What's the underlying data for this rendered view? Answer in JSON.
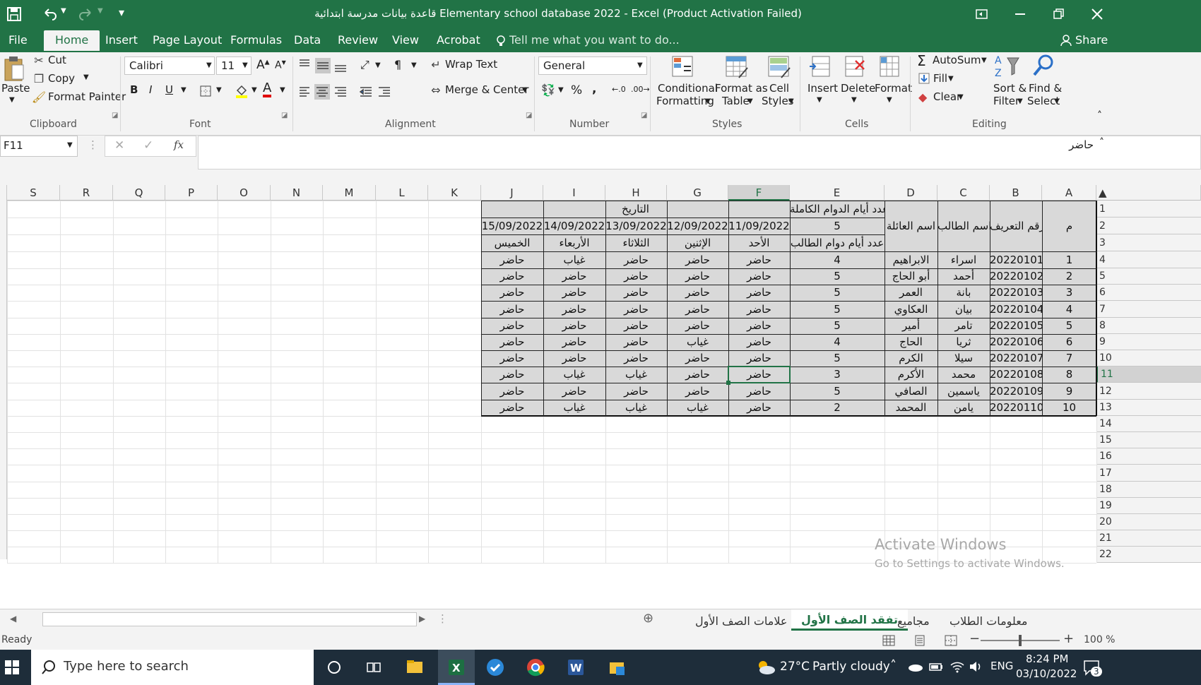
{
  "window": {
    "title": "قاعدة بيانات مدرسة ابتدائية Elementary school database 2022 - Excel (Product Activation Failed)",
    "restore_icon": "restore-icon",
    "minimize_icon": "minimize-icon",
    "maximize_icon": "maximize-icon",
    "close_icon": "close-icon"
  },
  "ribbon_tabs": [
    "File",
    "Home",
    "Insert",
    "Page Layout",
    "Formulas",
    "Data",
    "Review",
    "View",
    "Acrobat"
  ],
  "tell_me": "Tell me what you want to do...",
  "share": "Share",
  "clipboard": {
    "paste": "Paste",
    "cut": "Cut",
    "copy": "Copy",
    "format_painter": "Format Painter",
    "label": "Clipboard"
  },
  "font": {
    "name": "Calibri",
    "size": "11",
    "bold": "B",
    "italic": "I",
    "underline": "U",
    "label": "Font"
  },
  "alignment": {
    "wrap_text": "Wrap Text",
    "merge_center": "Merge & Center",
    "label": "Alignment"
  },
  "number": {
    "format": "General",
    "percent": "%",
    "comma": ",",
    "label": "Number"
  },
  "styles": {
    "conditional": "Conditional",
    "conditional2": "Formatting",
    "format_as": "Format as",
    "table": "Table",
    "cell": "Cell",
    "cell2": "Styles",
    "label": "Styles"
  },
  "cells": {
    "insert": "Insert",
    "delete": "Delete",
    "format": "Format",
    "label": "Cells"
  },
  "editing": {
    "autosum": "AutoSum",
    "fill": "Fill",
    "clear": "Clear",
    "sort": "Sort &",
    "sort2": "Filter",
    "find": "Find &",
    "find2": "Select",
    "label": "Editing"
  },
  "formula_bar": {
    "name_box": "F11",
    "fx": "fx",
    "value": "حاضر"
  },
  "columns": [
    "S",
    "R",
    "Q",
    "P",
    "O",
    "N",
    "M",
    "L",
    "K",
    "J",
    "I",
    "H",
    "G",
    "F",
    "E",
    "D",
    "C",
    "B",
    "A"
  ],
  "row_numbers": [
    "1",
    "2",
    "3",
    "4",
    "5",
    "6",
    "7",
    "8",
    "9",
    "10",
    "11",
    "12",
    "13",
    "14",
    "15",
    "16",
    "17",
    "18",
    "19",
    "20",
    "21",
    "22"
  ],
  "table": {
    "header_m": "م",
    "header_id": "رقم التعريف",
    "header_name": "اسم الطالب",
    "header_family": "اسم العائلة",
    "header_full_days": "عدد أيام الدوام الكاملة",
    "full_days_value": "5",
    "header_student_days": "عدد أيام دوام الطالب",
    "header_date": "التاريخ",
    "dates": [
      "11/09/2022",
      "12/09/2022",
      "13/09/2022",
      "14/09/2022",
      "15/09/2022"
    ],
    "days": [
      "الأحد",
      "الإثنين",
      "الثلاثاء",
      "الأربعاء",
      "الخميس"
    ],
    "rows": [
      {
        "m": "1",
        "id": "20220101",
        "name": "اسراء",
        "family": "الابراهيم",
        "count": "4",
        "att": [
          "حاضر",
          "حاضر",
          "حاضر",
          "غياب",
          "حاضر"
        ]
      },
      {
        "m": "2",
        "id": "20220102",
        "name": "أحمد",
        "family": "أبو الحاج",
        "count": "5",
        "att": [
          "حاضر",
          "حاضر",
          "حاضر",
          "حاضر",
          "حاضر"
        ]
      },
      {
        "m": "3",
        "id": "20220103",
        "name": "بانة",
        "family": "العمر",
        "count": "5",
        "att": [
          "حاضر",
          "حاضر",
          "حاضر",
          "حاضر",
          "حاضر"
        ]
      },
      {
        "m": "4",
        "id": "20220104",
        "name": "بيان",
        "family": "العكاوي",
        "count": "5",
        "att": [
          "حاضر",
          "حاضر",
          "حاضر",
          "حاضر",
          "حاضر"
        ]
      },
      {
        "m": "5",
        "id": "20220105",
        "name": "تامر",
        "family": "أمير",
        "count": "5",
        "att": [
          "حاضر",
          "حاضر",
          "حاضر",
          "حاضر",
          "حاضر"
        ]
      },
      {
        "m": "6",
        "id": "20220106",
        "name": "ثريا",
        "family": "الحاج",
        "count": "4",
        "att": [
          "حاضر",
          "غياب",
          "حاضر",
          "حاضر",
          "حاضر"
        ]
      },
      {
        "m": "7",
        "id": "20220107",
        "name": "سيلا",
        "family": "الكرم",
        "count": "5",
        "att": [
          "حاضر",
          "حاضر",
          "حاضر",
          "حاضر",
          "حاضر"
        ]
      },
      {
        "m": "8",
        "id": "20220108",
        "name": "محمد",
        "family": "الأكرم",
        "count": "3",
        "att": [
          "حاضر",
          "حاضر",
          "غياب",
          "غياب",
          "حاضر"
        ]
      },
      {
        "m": "9",
        "id": "20220109",
        "name": "ياسمين",
        "family": "الصافي",
        "count": "5",
        "att": [
          "حاضر",
          "حاضر",
          "حاضر",
          "حاضر",
          "حاضر"
        ]
      },
      {
        "m": "10",
        "id": "20220110",
        "name": "يامن",
        "family": "المحمد",
        "count": "2",
        "att": [
          "حاضر",
          "غياب",
          "غياب",
          "غياب",
          "حاضر"
        ]
      }
    ]
  },
  "sheet_tabs": [
    "علامات الصف الأول",
    "تفقد الصف الأول",
    "مجاميع",
    "معلومات الطلاب"
  ],
  "active_sheet": "تفقد الصف الأول",
  "watermark": {
    "line1": "Activate Windows",
    "line2": "Go to Settings to activate Windows."
  },
  "status": {
    "ready": "Ready",
    "zoom": "100 %"
  },
  "taskbar": {
    "search": "Type here to search",
    "temp": "27°C",
    "weather": "Partly cloudy",
    "lang": "ENG",
    "time": "8:24 PM",
    "date": "03/10/2022",
    "notif_count": "3"
  }
}
